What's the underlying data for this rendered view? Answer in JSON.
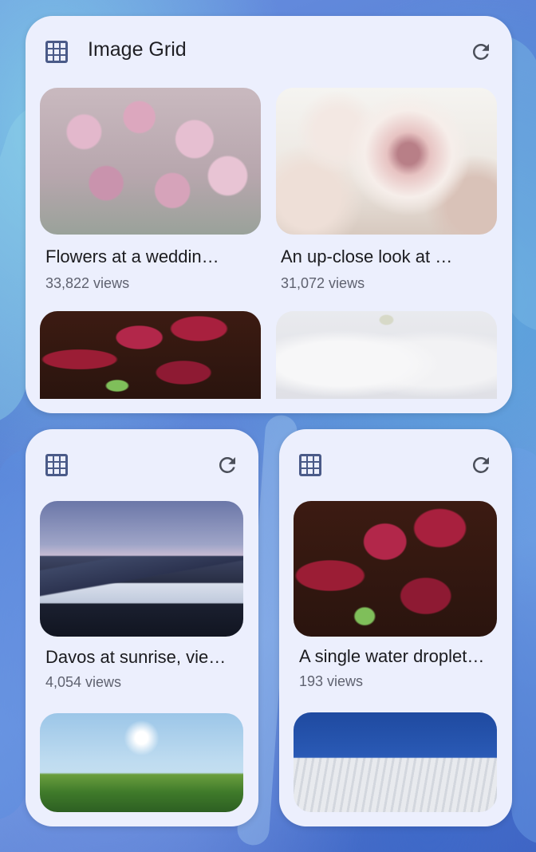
{
  "wallpaper": {
    "accent": "#4b78cf"
  },
  "widgets": {
    "large": {
      "title": "Image Grid",
      "grid_icon": "grid-icon",
      "refresh_icon": "refresh-icon",
      "items": [
        {
          "caption": "Flowers at a weddin…",
          "views": "33,822 views"
        },
        {
          "caption": "An up-close look at …",
          "views": "31,072 views"
        }
      ]
    },
    "left": {
      "grid_icon": "grid-icon",
      "refresh_icon": "refresh-icon",
      "items": [
        {
          "caption": "Davos at sunrise, vie…",
          "views": "4,054 views"
        }
      ]
    },
    "right": {
      "grid_icon": "grid-icon",
      "refresh_icon": "refresh-icon",
      "items": [
        {
          "caption": "A single water droplet…",
          "views": "193 views"
        }
      ]
    }
  },
  "colors": {
    "widget_bg": "#eceffd",
    "icon": "#4a5a88",
    "refresh": "#4b4f5a"
  }
}
